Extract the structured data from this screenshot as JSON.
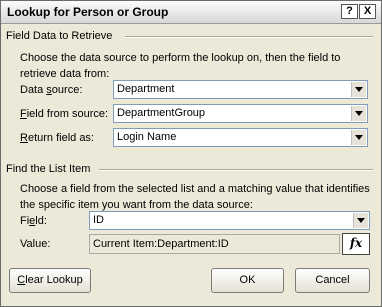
{
  "window": {
    "title": "Lookup for Person or Group",
    "help_glyph": "?",
    "close_glyph": "X"
  },
  "section1": {
    "title": "Field Data to Retrieve",
    "description": "Choose the data source to perform the lookup on, then the field to retrieve data from:",
    "data_source": {
      "label_prefix": "Data ",
      "label_accel": "s",
      "label_suffix": "ource:",
      "value": "Department"
    },
    "field_from_source": {
      "label_accel": "F",
      "label_suffix": "ield from source:",
      "value": "DepartmentGroup"
    },
    "return_field": {
      "label_accel": "R",
      "label_suffix": "eturn field as:",
      "value": "Login Name"
    }
  },
  "section2": {
    "title": "Find the List Item",
    "description": "Choose a field from the selected list and a matching value that identifies the specific item you want from the data source:",
    "field": {
      "label_prefix": "Fi",
      "label_accel": "e",
      "label_suffix": "ld:",
      "value": "ID"
    },
    "value": {
      "label": "Value:",
      "value": "Current Item:Department:ID"
    },
    "fx_label": "fx"
  },
  "buttons": {
    "clear_lookup_accel": "C",
    "clear_lookup_rest": "lear Lookup",
    "ok": "OK",
    "cancel": "Cancel"
  }
}
